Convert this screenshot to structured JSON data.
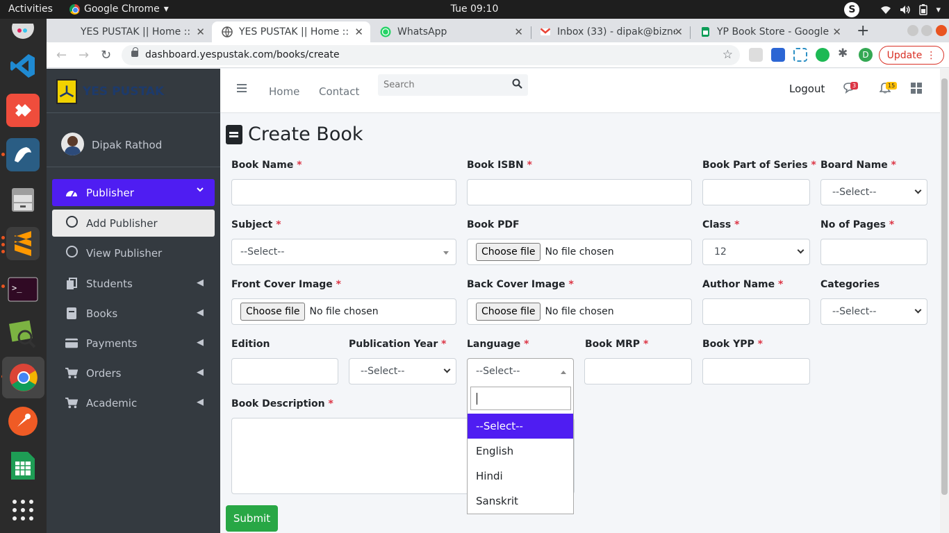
{
  "os": {
    "activities": "Activities",
    "app_menu": "Google Chrome",
    "clock": "Tue 09:10",
    "tray_s": "S"
  },
  "browser": {
    "tabs": [
      {
        "label": "YES PUSTAK || Home ::"
      },
      {
        "label": "YES PUSTAK || Home ::"
      },
      {
        "label": "WhatsApp"
      },
      {
        "label": "Inbox (33) - dipak@bizne"
      },
      {
        "label": "YP Book Store - Google"
      }
    ],
    "url": "dashboard.yespustak.com/books/create",
    "profile_initial": "D",
    "update_label": "Update"
  },
  "sidebar": {
    "brand": "YES PUSTAK",
    "user_name": "Dipak Rathod",
    "items": [
      {
        "label": "Publisher"
      },
      {
        "label": "Add Publisher"
      },
      {
        "label": "View Publisher"
      },
      {
        "label": "Students"
      },
      {
        "label": "Books"
      },
      {
        "label": "Payments"
      },
      {
        "label": "Orders"
      },
      {
        "label": "Academic"
      }
    ]
  },
  "navbar": {
    "home": "Home",
    "contact": "Contact",
    "search_placeholder": "Search",
    "logout": "Logout",
    "messages_count": "3",
    "notifications_count": "15"
  },
  "page": {
    "title": "Create Book",
    "required_mark": "*",
    "file_button": "Choose file",
    "file_none": "No file chosen",
    "select_placeholder": "--Select--",
    "fields": {
      "book_name": "Book Name",
      "book_isbn": "Book ISBN",
      "part_of_series": "Book Part of Series",
      "board_name": "Board Name",
      "subject": "Subject",
      "book_pdf": "Book PDF",
      "class": "Class",
      "class_value": "12",
      "no_of_pages": "No of Pages",
      "front_cover": "Front Cover Image",
      "back_cover": "Back Cover Image",
      "author_name": "Author Name",
      "categories": "Categories",
      "edition": "Edition",
      "publication_year": "Publication Year",
      "language": "Language",
      "book_mrp": "Book MRP",
      "book_ypp": "Book YPP",
      "book_description": "Book Description"
    },
    "language_options": [
      "--Select--",
      "English",
      "Hindi",
      "Sanskrit"
    ],
    "submit": "Submit"
  },
  "colors": {
    "accent": "#4f1df2",
    "sidebar_bg": "#343a40",
    "submit": "#28a745",
    "required": "#dc3545",
    "update": "#d93025"
  }
}
